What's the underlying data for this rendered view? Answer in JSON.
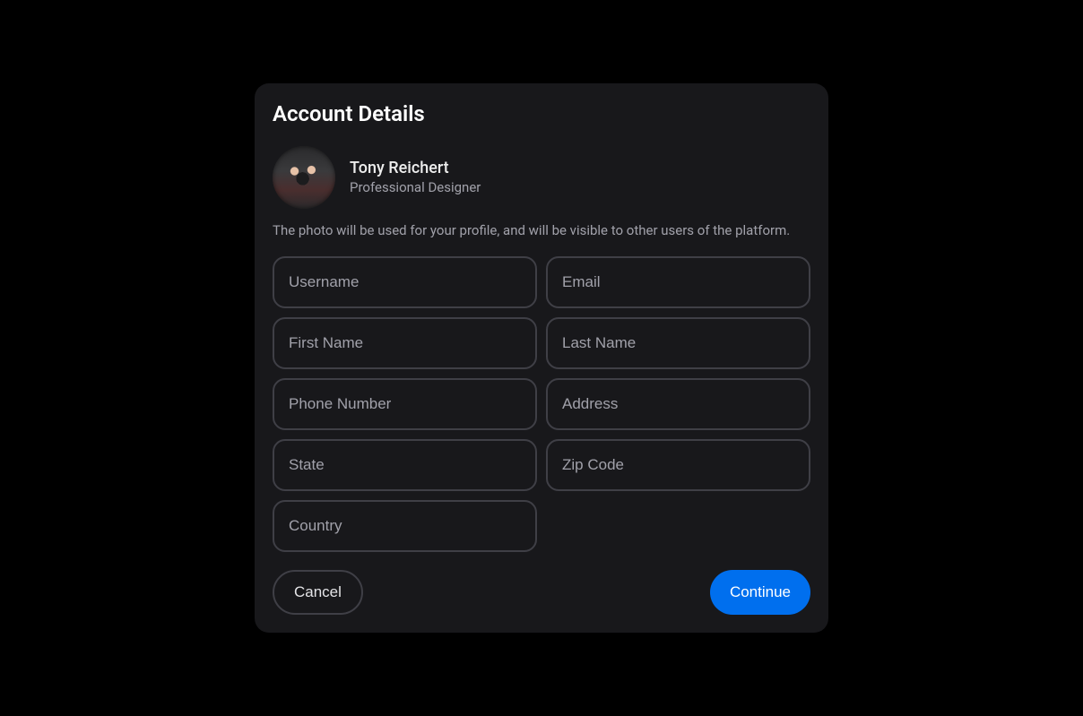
{
  "title": "Account Details",
  "profile": {
    "name": "Tony Reichert",
    "role": "Professional Designer"
  },
  "helper": "The photo will be used for your profile, and will be visible to other users of the platform.",
  "fields": {
    "username": {
      "placeholder": "Username",
      "value": ""
    },
    "email": {
      "placeholder": "Email",
      "value": ""
    },
    "first_name": {
      "placeholder": "First Name",
      "value": ""
    },
    "last_name": {
      "placeholder": "Last Name",
      "value": ""
    },
    "phone": {
      "placeholder": "Phone Number",
      "value": ""
    },
    "address": {
      "placeholder": "Address",
      "value": ""
    },
    "state": {
      "placeholder": "State",
      "value": ""
    },
    "zip": {
      "placeholder": "Zip Code",
      "value": ""
    },
    "country": {
      "placeholder": "Country",
      "value": ""
    }
  },
  "buttons": {
    "cancel": "Cancel",
    "continue": "Continue"
  }
}
